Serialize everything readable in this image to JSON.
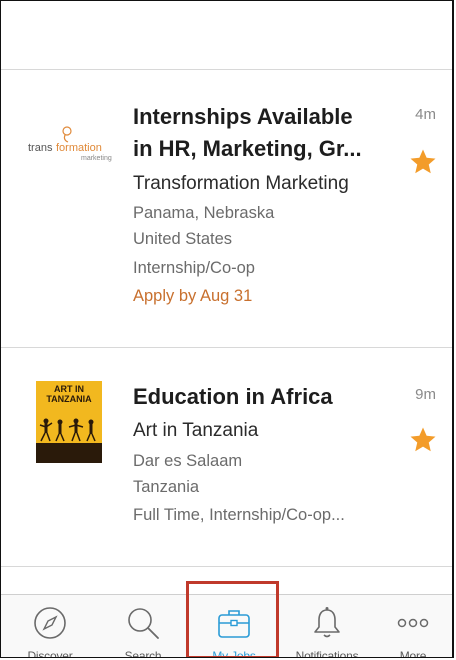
{
  "jobs": [
    {
      "title_line1": "Internships Available",
      "title_line2": "in HR, Marketing, Gr...",
      "company": "Transformation Marketing",
      "location_line1": "Panama, Nebraska",
      "location_line2": "United States",
      "job_type": "Internship/Co-op",
      "deadline": "Apply by Aug 31",
      "posted": "4m",
      "starred": true,
      "logo": {
        "word_a": "trans",
        "word_b": "formation",
        "word_c": "marketing"
      }
    },
    {
      "title_line1": "Education in Africa",
      "company": "Art in Tanzania",
      "location_line1": "Dar es Salaam",
      "location_line2": "Tanzania",
      "job_type": "Full Time, Internship/Co-op...",
      "posted": "9m",
      "starred": true,
      "logo": {
        "line1": "ART IN",
        "line2": "TANZANIA"
      }
    }
  ],
  "tabs": [
    {
      "label": "Discover",
      "icon": "compass-icon"
    },
    {
      "label": "Search",
      "icon": "search-icon"
    },
    {
      "label": "My Jobs",
      "icon": "briefcase-icon",
      "active": true
    },
    {
      "label": "Notifications",
      "icon": "bell-icon"
    },
    {
      "label": "More",
      "icon": "more-icon"
    }
  ],
  "colors": {
    "accent": "#2a9bd6",
    "star": "#f39c2a",
    "deadline": "#c8702e",
    "highlight": "#c0392b"
  }
}
